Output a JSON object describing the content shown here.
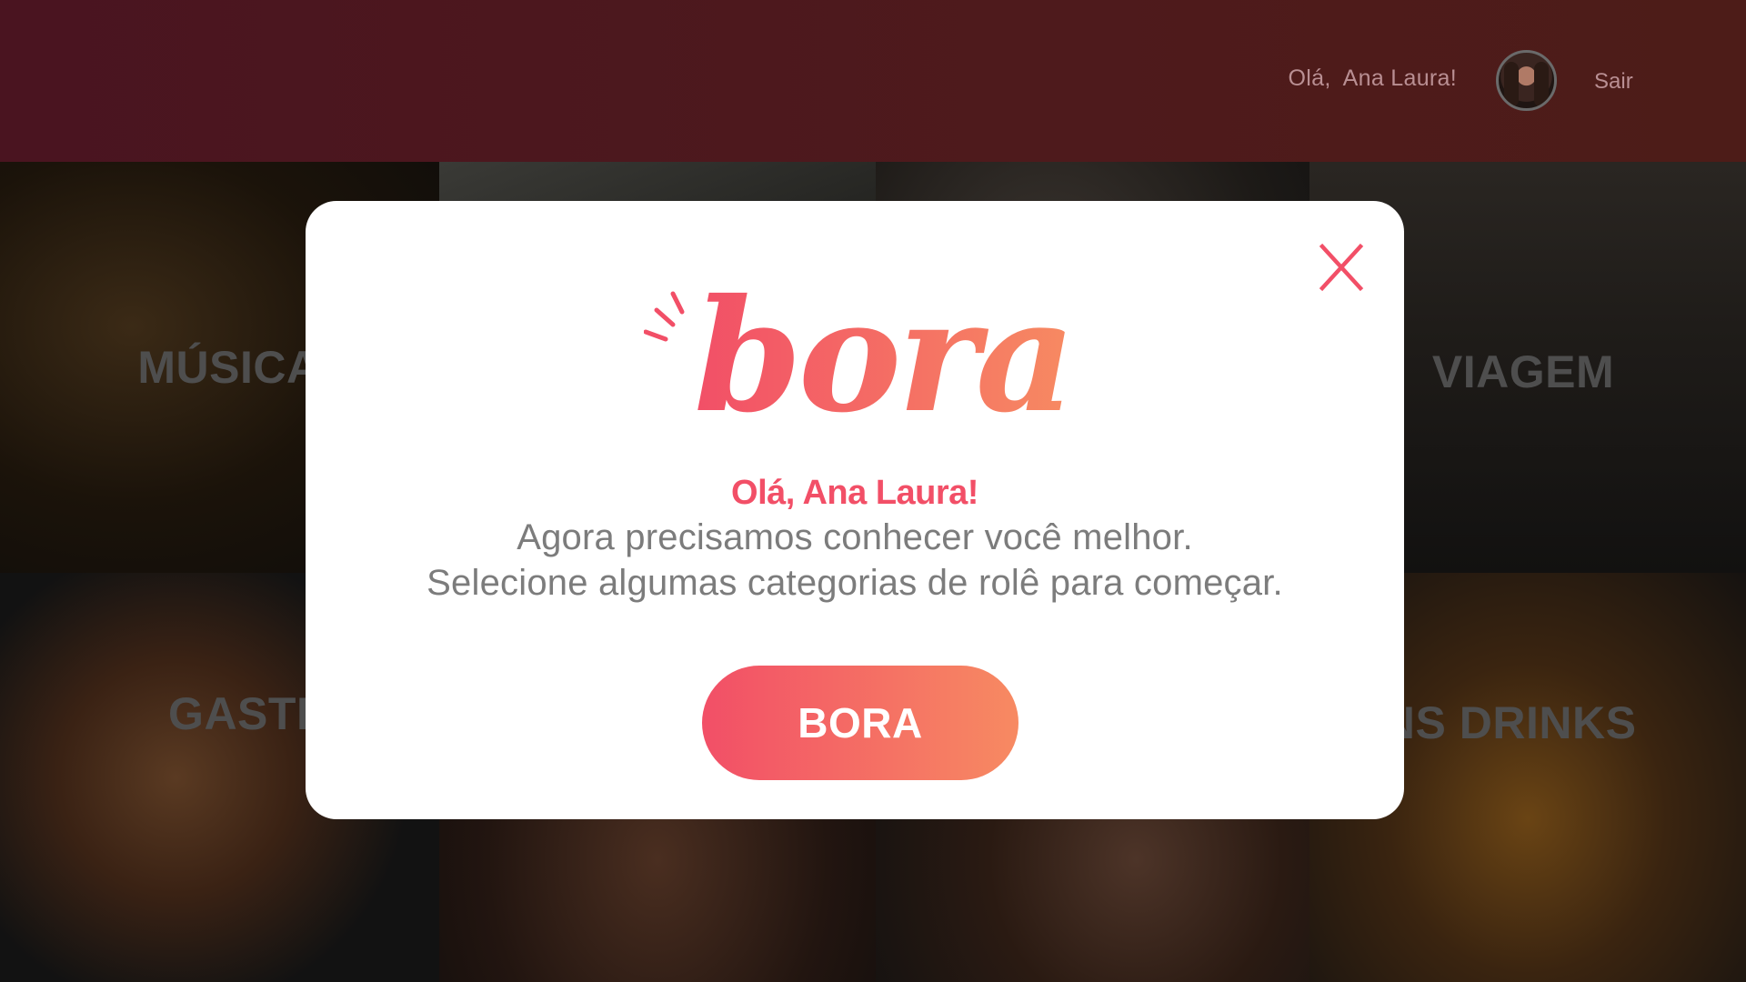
{
  "header": {
    "greeting": "Olá,  Ana Laura!",
    "logout_label": "Sair"
  },
  "categories": [
    {
      "label": "MÚSICA"
    },
    {
      "label": ""
    },
    {
      "label": ""
    },
    {
      "label": "VIAGEM"
    },
    {
      "label": "GASTRONO"
    },
    {
      "label": ""
    },
    {
      "label": ""
    },
    {
      "label": "ONS DRINKS"
    }
  ],
  "modal": {
    "logo_text": "bora",
    "close_label": "X",
    "hello": "Olá, Ana Laura!",
    "line1": "Agora precisamos conhecer você melhor.",
    "line2": "Selecione algumas categorias de rolê para começar.",
    "cta_label": "BORA"
  },
  "colors": {
    "brand_pink": "#f24f67",
    "brand_orange": "#f78a62",
    "header_bg": "#4a1420"
  }
}
